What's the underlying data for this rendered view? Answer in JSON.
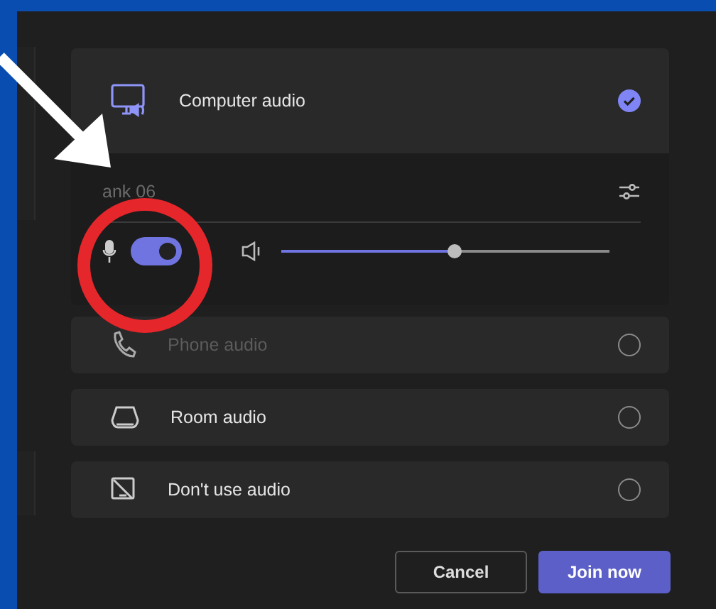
{
  "options": [
    {
      "kind": "computer",
      "label": "Computer audio",
      "selected": true,
      "disabled": false
    },
    {
      "kind": "phone",
      "label": "Phone audio",
      "selected": false,
      "disabled": true
    },
    {
      "kind": "room",
      "label": "Room audio",
      "selected": false,
      "disabled": false
    },
    {
      "kind": "none",
      "label": "Don't use audio",
      "selected": false,
      "disabled": false
    }
  ],
  "device": {
    "name": "ank 06",
    "mic_on": true,
    "volume": {
      "level": 0.53
    }
  },
  "buttons": [
    {
      "label": "Cancel",
      "kind": "secondary"
    },
    {
      "label": "Join now",
      "kind": "primary"
    }
  ]
}
